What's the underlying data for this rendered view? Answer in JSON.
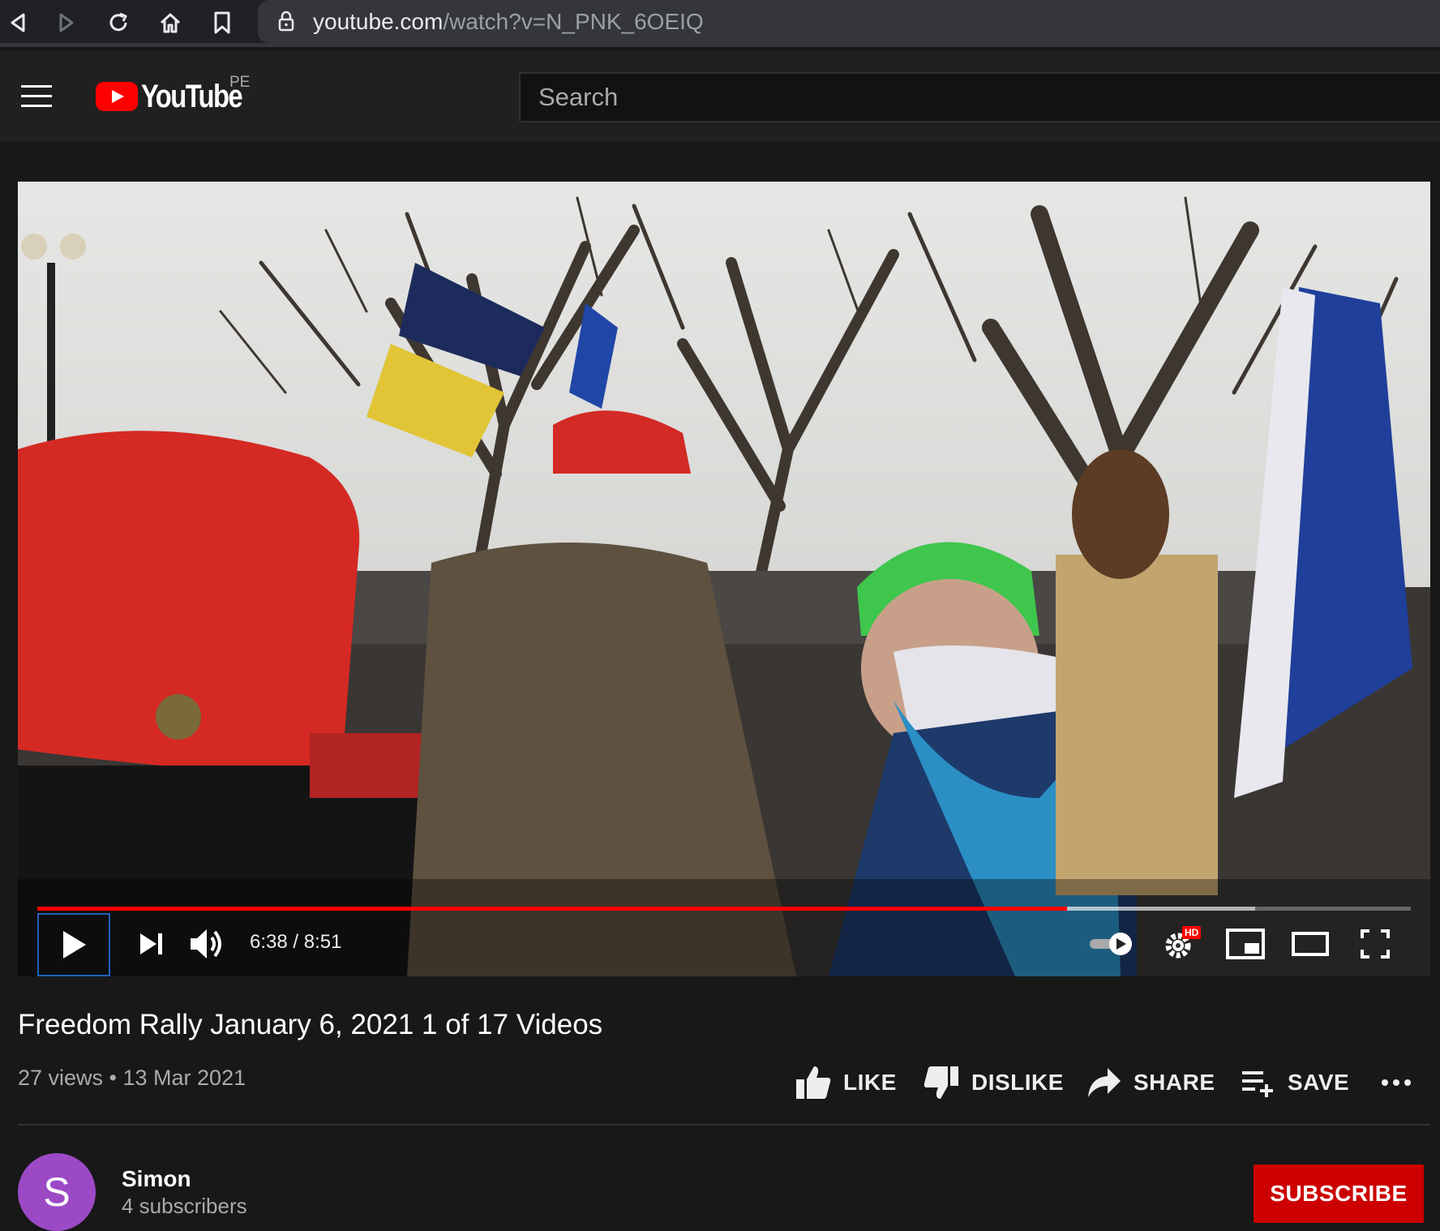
{
  "browser": {
    "url_host": "youtube.com",
    "url_path": "/watch?v=N_PNK_6OEIQ"
  },
  "header": {
    "logo_text": "YouTube",
    "country_code": "PE",
    "search_placeholder": "Search"
  },
  "player": {
    "current_time": "6:38",
    "duration": "8:51",
    "time_display": "6:38 / 8:51",
    "progress_fraction": 0.7495,
    "buffered_fraction": 0.8865,
    "hd_badge": "HD",
    "icons": [
      "play-icon",
      "next-icon",
      "volume-icon",
      "autoplay-toggle-icon",
      "settings-icon",
      "miniplayer-icon",
      "theater-icon",
      "fullscreen-icon"
    ]
  },
  "video": {
    "title": "Freedom Rally January 6, 2021 1 of 17 Videos",
    "meta": "27 views • 13 Mar 2021",
    "actions": {
      "like": "LIKE",
      "dislike": "DISLIKE",
      "share": "SHARE",
      "save": "SAVE"
    }
  },
  "channel": {
    "avatar_letter": "S",
    "name": "Simon",
    "subscribers": "4 subscribers",
    "subscribe_label": "SUBSCRIBE"
  },
  "colors": {
    "brand_red": "#ff0000",
    "subscribe_red": "#cc0000",
    "avatar_purple": "#9c49c6",
    "background": "#181818"
  }
}
